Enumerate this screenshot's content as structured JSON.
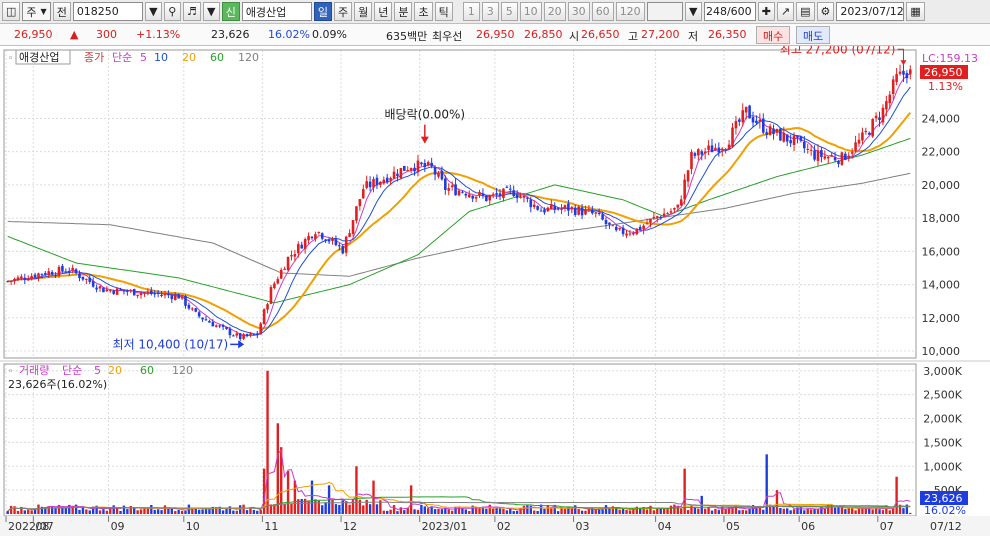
{
  "toolbar": {
    "market_label": "주",
    "prev_label": "전",
    "code": "018250",
    "sin_badge": "신",
    "stock_name": "애경산업",
    "periods": [
      "일",
      "주",
      "월",
      "년",
      "분",
      "초",
      "틱"
    ],
    "active_period": "일",
    "intervals": [
      "1",
      "3",
      "5",
      "10",
      "20",
      "30",
      "60",
      "120"
    ],
    "count": "248/600",
    "date": "2023/07/12"
  },
  "quote": {
    "price": "26,950",
    "change": "300",
    "change_pct": "+1.13%",
    "volume": "23,626",
    "volume_ratio": "16.02%",
    "turnover": "0.09%",
    "amount": "635백만",
    "best_label": "최우선",
    "ask": "26,950",
    "bid": "26,850",
    "open_label": "시",
    "open": "26,650",
    "high_label": "고",
    "high": "27,200",
    "low_label": "저",
    "low": "26,350",
    "buy_label": "매수",
    "sell_label": "매도"
  },
  "colors": {
    "up": "#e02020",
    "down": "#1e3ce0",
    "ma5": "#c83cc8",
    "ma10": "#1e50d2",
    "ma20": "#f0a000",
    "ma60": "#28a028",
    "ma120": "#808080",
    "accent": "#2f62b8"
  },
  "chart_data": [
    {
      "type": "line",
      "name": "price",
      "legend_name": "애경산업",
      "legend_ma": [
        "종가",
        "단순",
        "5",
        "10",
        "20",
        "60",
        "120"
      ],
      "ylim": [
        9700,
        28000
      ],
      "yticks": [
        10000,
        12000,
        14000,
        16000,
        18000,
        20000,
        22000,
        24000
      ],
      "y_tick_labels": [
        "10,000",
        "12,000",
        "14,000",
        "16,000",
        "18,000",
        "20,000",
        "22,000",
        "24,000"
      ],
      "x_labels": [
        "2022/07",
        "08",
        "09",
        "10",
        "11",
        "12",
        "2023/01",
        "02",
        "03",
        "04",
        "05",
        "06",
        "07"
      ],
      "x_label_index": [
        0,
        8,
        30,
        52,
        75,
        98,
        121,
        143,
        166,
        190,
        210,
        232,
        255
      ],
      "n": 265,
      "close_anchors": [
        [
          0,
          14200
        ],
        [
          10,
          14700
        ],
        [
          18,
          14900
        ],
        [
          28,
          13700
        ],
        [
          40,
          13500
        ],
        [
          50,
          13300
        ],
        [
          55,
          12200
        ],
        [
          63,
          11300
        ],
        [
          68,
          10800
        ],
        [
          73,
          11000
        ],
        [
          77,
          13700
        ],
        [
          82,
          15600
        ],
        [
          90,
          17300
        ],
        [
          98,
          16100
        ],
        [
          104,
          19800
        ],
        [
          118,
          21200
        ],
        [
          124,
          21000
        ],
        [
          128,
          19800
        ],
        [
          134,
          19600
        ],
        [
          140,
          19200
        ],
        [
          148,
          19600
        ],
        [
          156,
          18500
        ],
        [
          164,
          18600
        ],
        [
          172,
          18200
        ],
        [
          178,
          17100
        ],
        [
          184,
          17300
        ],
        [
          190,
          18100
        ],
        [
          196,
          18600
        ],
        [
          200,
          21700
        ],
        [
          210,
          22500
        ],
        [
          216,
          24400
        ],
        [
          222,
          23300
        ],
        [
          230,
          22600
        ],
        [
          236,
          21800
        ],
        [
          244,
          21600
        ],
        [
          250,
          22800
        ],
        [
          256,
          24500
        ],
        [
          260,
          26400
        ],
        [
          264,
          26950
        ]
      ],
      "ma_levels": {
        "ma60": [
          [
            0,
            16900
          ],
          [
            20,
            15300
          ],
          [
            50,
            14400
          ],
          [
            78,
            12900
          ],
          [
            100,
            14000
          ],
          [
            120,
            15800
          ],
          [
            135,
            18400
          ],
          [
            160,
            20000
          ],
          [
            180,
            19100
          ],
          [
            192,
            18100
          ],
          [
            205,
            19100
          ],
          [
            225,
            20500
          ],
          [
            250,
            21800
          ],
          [
            264,
            22800
          ]
        ],
        "ma120": [
          [
            0,
            17800
          ],
          [
            30,
            17600
          ],
          [
            60,
            16500
          ],
          [
            80,
            14700
          ],
          [
            100,
            14500
          ],
          [
            120,
            15600
          ],
          [
            145,
            16700
          ],
          [
            170,
            17400
          ],
          [
            190,
            18000
          ],
          [
            210,
            18600
          ],
          [
            230,
            19500
          ],
          [
            250,
            20100
          ],
          [
            264,
            20700
          ]
        ]
      },
      "annotations": [
        {
          "text": "최고 27,200 (07/12)",
          "index": 262,
          "value": 27200
        },
        {
          "text": "최저 10,400 (10/17)",
          "index": 68,
          "value": 10400
        },
        {
          "text": "배당락(0.00%)",
          "index": 122,
          "value": 21700
        }
      ],
      "price_tags": {
        "current": "26,950",
        "change_pct": "1.13%",
        "lc": "LC:159.13"
      }
    },
    {
      "type": "bar",
      "name": "volume",
      "legend_name": "거래량",
      "legend_ma": [
        "단순",
        "5",
        "20",
        "60",
        "120"
      ],
      "info": "23,626주(16.02%)",
      "ylim": [
        0,
        3100000
      ],
      "yticks": [
        500000,
        1000000,
        1500000,
        2000000,
        2500000,
        3000000
      ],
      "y_tick_labels": [
        "500K",
        "1,000K",
        "1,500K",
        "2,000K",
        "2,500K",
        "3,000K"
      ],
      "spikes": [
        [
          75,
          950000
        ],
        [
          76,
          3000000
        ],
        [
          79,
          1900000
        ],
        [
          80,
          1400000
        ],
        [
          82,
          900000
        ],
        [
          84,
          700000
        ],
        [
          89,
          700000
        ],
        [
          94,
          600000
        ],
        [
          102,
          1000000
        ],
        [
          107,
          700000
        ],
        [
          118,
          600000
        ],
        [
          198,
          950000
        ],
        [
          222,
          1250000
        ],
        [
          260,
          780000
        ],
        [
          203,
          380000
        ],
        [
          225,
          500000
        ]
      ],
      "current": "23,626",
      "current_pct": "16.02%",
      "last_date": "07/12"
    }
  ]
}
